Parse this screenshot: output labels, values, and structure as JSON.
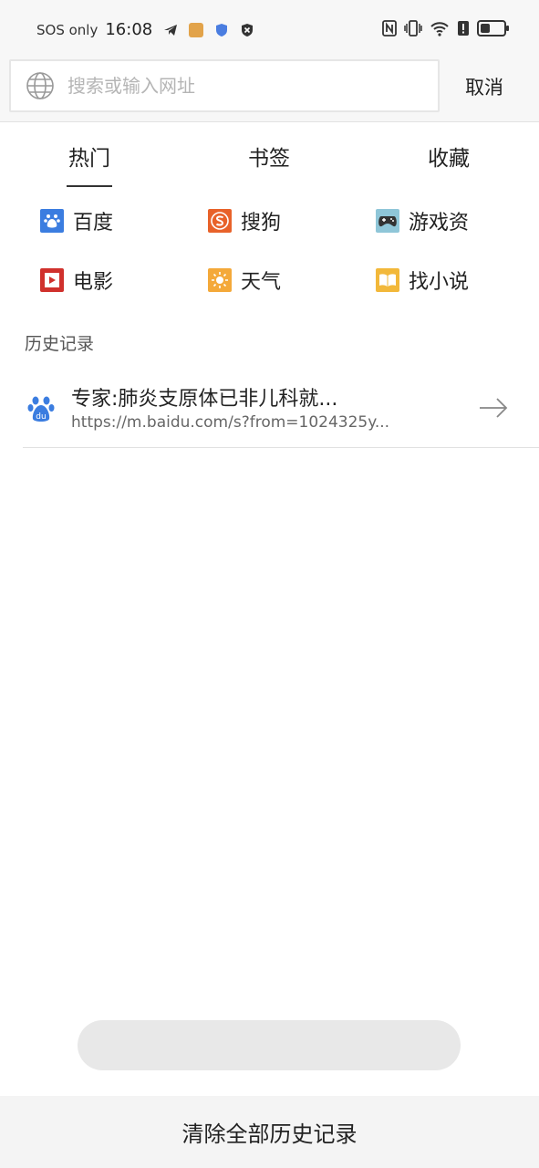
{
  "status_bar": {
    "carrier": "SOS only",
    "time": "16:08",
    "icons": [
      "telegram-icon",
      "input-method-icon",
      "shield-icon",
      "vpn-icon",
      "nfc-icon",
      "vibrate-icon",
      "wifi-icon",
      "alert-icon",
      "battery-icon"
    ]
  },
  "search": {
    "placeholder": "搜索或输入网址",
    "value": "",
    "cancel_label": "取消"
  },
  "tabs": [
    {
      "label": "热门",
      "active": true
    },
    {
      "label": "书签",
      "active": false
    },
    {
      "label": "收藏",
      "active": false
    }
  ],
  "quick_links": [
    {
      "label": "百度",
      "icon": "baidu-icon",
      "color": "#3b7de0"
    },
    {
      "label": "搜狗",
      "icon": "sogou-icon",
      "color": "#e8622a"
    },
    {
      "label": "游戏资",
      "icon": "gamepad-icon",
      "color": "#8fc6d8"
    },
    {
      "label": "电影",
      "icon": "movie-icon",
      "color": "#d0312d"
    },
    {
      "label": "天气",
      "icon": "weather-icon",
      "color": "#f4a93a"
    },
    {
      "label": "找小说",
      "icon": "book-icon",
      "color": "#f2b83a"
    }
  ],
  "history": {
    "title": "历史记录",
    "items": [
      {
        "title": "专家:肺炎支原体已非儿科就...",
        "url": "https://m.baidu.com/s?from=1024325y...",
        "icon": "baidu-paw-icon"
      }
    ]
  },
  "bottom": {
    "clear_label": "清除全部历史记录"
  },
  "colors": {
    "accent": "#222222",
    "baidu_blue": "#3b7de0",
    "bar_bg": "#f7f7f7"
  }
}
